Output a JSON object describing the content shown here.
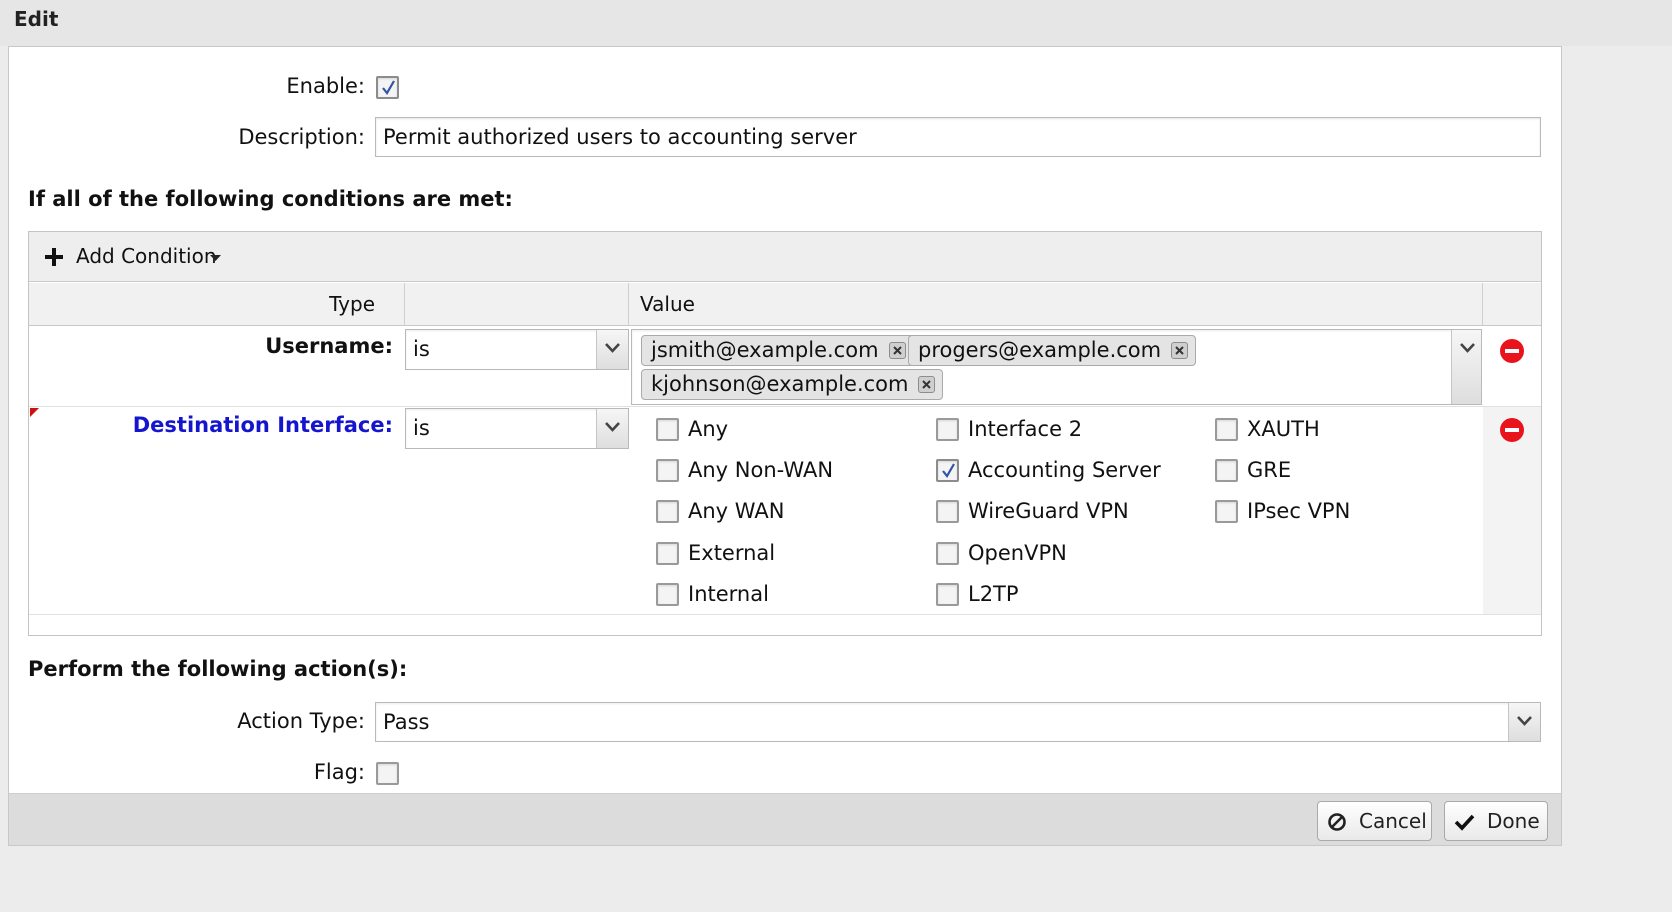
{
  "window": {
    "title": "Edit"
  },
  "form": {
    "enable_label": "Enable:",
    "enable_checked": true,
    "description_label": "Description:",
    "description_value": "Permit authorized users to accounting server"
  },
  "conditions": {
    "heading": "If all of the following conditions are met:",
    "add_condition_label": "Add Condition",
    "columns": {
      "type": "Type",
      "operator": "",
      "value": "Value"
    },
    "rows": [
      {
        "type": "Username:",
        "operator": "is",
        "values": [
          "jsmith@example.com",
          "progers@example.com",
          "kjohnson@example.com"
        ]
      },
      {
        "type": "Destination Interface:",
        "operator": "is",
        "options": [
          {
            "label": "Any",
            "checked": false
          },
          {
            "label": "Any Non-WAN",
            "checked": false
          },
          {
            "label": "Any WAN",
            "checked": false
          },
          {
            "label": "External",
            "checked": false
          },
          {
            "label": "Internal",
            "checked": false
          },
          {
            "label": "Interface 2",
            "checked": false
          },
          {
            "label": "Accounting Server",
            "checked": true
          },
          {
            "label": "WireGuard VPN",
            "checked": false
          },
          {
            "label": "OpenVPN",
            "checked": false
          },
          {
            "label": "L2TP",
            "checked": false
          },
          {
            "label": "XAUTH",
            "checked": false
          },
          {
            "label": "GRE",
            "checked": false
          },
          {
            "label": "IPsec VPN",
            "checked": false
          }
        ]
      }
    ]
  },
  "actions": {
    "heading": "Perform the following action(s):",
    "action_type_label": "Action Type:",
    "action_type_value": "Pass",
    "flag_label": "Flag:",
    "flag_checked": false
  },
  "footer": {
    "cancel_label": "Cancel",
    "done_label": "Done"
  },
  "colors": {
    "link_blue": "#1515d0",
    "remove_red": "#e8131b",
    "check_blue": "#2f55a6"
  }
}
